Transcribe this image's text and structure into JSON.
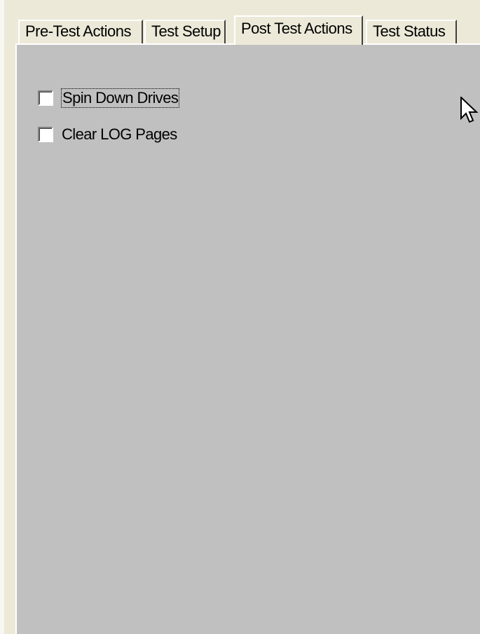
{
  "tabs": [
    {
      "label": "Pre-Test Actions",
      "active": false
    },
    {
      "label": "Test Setup",
      "active": false
    },
    {
      "label": "Post Test Actions",
      "active": true
    },
    {
      "label": "Test Status",
      "active": false
    }
  ],
  "post_test_actions": {
    "options": [
      {
        "label": "Spin Down Drives",
        "checked": false,
        "focused": true
      },
      {
        "label": "Clear LOG Pages",
        "checked": false,
        "focused": false
      }
    ]
  },
  "colors": {
    "window_bg": "#ece9d8",
    "panel_bg": "#c0c0c0",
    "checkbox_bg": "#ffffff"
  },
  "icons": [
    "arrow-pointer-icon"
  ]
}
